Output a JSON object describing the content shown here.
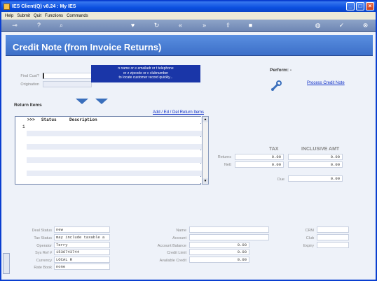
{
  "window": {
    "title": "IES Client(Q) v8.24 : My IES"
  },
  "menu": [
    "Help",
    "Submit",
    "Quit",
    "Functions",
    "Commands"
  ],
  "page": {
    "title": "Credit Note (from Invoice Returns)"
  },
  "search": {
    "find_label": "Find Cust?",
    "origination_label": "Origination",
    "tooltip_line1": "n name or e emailadr or t telephone",
    "tooltip_line2": "or z zipcode or c clubnumber",
    "tooltip_line3": "to locate customer record quickly..."
  },
  "perform": {
    "label": "Perform: -",
    "process_link": "Process Credit Note"
  },
  "items": {
    "section_title": "Return Items",
    "edit_link": "Add / Ed / Del Return Items",
    "col_marker": ">>>",
    "col_status": "Status",
    "col_description": "Description",
    "row_number": "1"
  },
  "totals": {
    "tax_header": "TAX",
    "incl_header": "INCLUSIVE AMT",
    "returns_label": "Returns",
    "nett_label": "Nett",
    "due_label": "Due",
    "returns_tax": "0.00",
    "returns_incl": "0.00",
    "nett_tax": "0.00",
    "nett_incl": "0.00",
    "due_value": "0.00"
  },
  "deal": {
    "deal_status_label": "Deal Status",
    "deal_status": "new",
    "tax_status_label": "Tax Status",
    "tax_status": "may include taxable a",
    "operator_label": "Operator",
    "operator": "Terry",
    "sys_ref_label": "Sys Ref #",
    "sys_ref": "1536743744",
    "currency_label": "Currency",
    "currency": "LOCAL R",
    "rate_book_label": "Rate Book",
    "rate_book": "none"
  },
  "account": {
    "name_label": "Name",
    "account_label": "Account",
    "balance_label": "Account Balance",
    "balance": "0.00",
    "limit_label": "Credit Limit",
    "limit": "0.00",
    "available_label": "Available Credit",
    "available": "0.00"
  },
  "crm": {
    "crm_label": "CRM",
    "club_label": "Club",
    "expiry_label": "Expiry"
  }
}
